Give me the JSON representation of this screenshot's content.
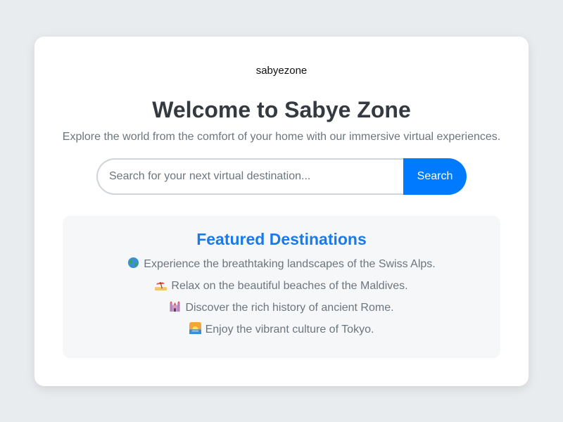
{
  "brand": {
    "logo_text": "sabyezone"
  },
  "hero": {
    "title": "Welcome to Sabye Zone",
    "subtitle": "Explore the world from the comfort of your home with our immersive virtual experiences."
  },
  "search": {
    "placeholder": "Search for your next virtual destination...",
    "value": "",
    "button_label": "Search",
    "button_color": "#007bff"
  },
  "featured": {
    "title": "Featured Destinations",
    "title_color": "#1a7ae8",
    "items": [
      {
        "icon": "globe-icon",
        "text": "Experience the breathtaking landscapes of the Swiss Alps."
      },
      {
        "icon": "beach-umbrella-icon",
        "text": "Relax on the beautiful beaches of the Maldives."
      },
      {
        "icon": "castle-icon",
        "text": "Discover the rich history of ancient Rome."
      },
      {
        "icon": "sunrise-icon",
        "text": "Enjoy the vibrant culture of Tokyo."
      }
    ]
  }
}
